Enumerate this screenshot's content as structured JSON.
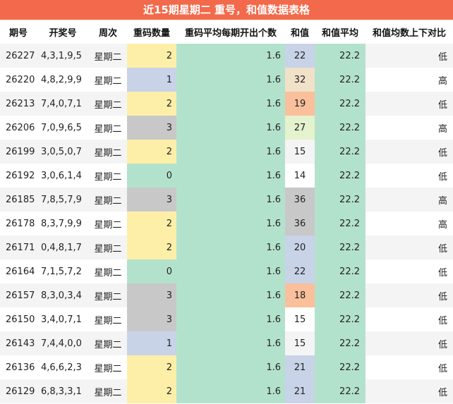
{
  "title": "近15期星期二 重号，和值数据表格",
  "headers": [
    "期号",
    "开奖号",
    "周次",
    "重码数量",
    "重码平均每期开出个数",
    "和值",
    "和值平均",
    "和值均数上下对比"
  ],
  "colors": {
    "header_bar": "#f26a4b",
    "avg_columns": "#b3e2cc",
    "dup_2": "#fdefa8",
    "dup_1": "#c8d3e8",
    "dup_3": "#c8c8c8",
    "dup_0": "#b3e2cc",
    "sum_blue": "#c8d3e8",
    "sum_beige": "#f1e1c8",
    "sum_orange": "#f9c09b",
    "sum_lightgreen": "#e4f2cd",
    "sum_gray": "#c8c8c8"
  },
  "rows": [
    {
      "period": "26227",
      "numbers": "4,3,1,9,5",
      "weekday": "星期二",
      "dup": "2",
      "avg_dup": "1.6",
      "sum": "22",
      "avg_sum": "22.2",
      "compare": "低",
      "dup_color": "#fdefa8",
      "sum_color": "#c8d3e8"
    },
    {
      "period": "26220",
      "numbers": "4,8,2,9,9",
      "weekday": "星期二",
      "dup": "1",
      "avg_dup": "1.6",
      "sum": "32",
      "avg_sum": "22.2",
      "compare": "高",
      "dup_color": "#c8d3e8",
      "sum_color": "#f1e1c8"
    },
    {
      "period": "26213",
      "numbers": "7,4,0,7,1",
      "weekday": "星期二",
      "dup": "2",
      "avg_dup": "1.6",
      "sum": "19",
      "avg_sum": "22.2",
      "compare": "低",
      "dup_color": "#fdefa8",
      "sum_color": "#f9c09b"
    },
    {
      "period": "26206",
      "numbers": "7,0,9,6,5",
      "weekday": "星期二",
      "dup": "3",
      "avg_dup": "1.6",
      "sum": "27",
      "avg_sum": "22.2",
      "compare": "高",
      "dup_color": "#c8c8c8",
      "sum_color": "#e4f2cd"
    },
    {
      "period": "26199",
      "numbers": "3,0,5,0,7",
      "weekday": "星期二",
      "dup": "2",
      "avg_dup": "1.6",
      "sum": "15",
      "avg_sum": "22.2",
      "compare": "低",
      "dup_color": "#fdefa8",
      "sum_color": ""
    },
    {
      "period": "26192",
      "numbers": "3,0,6,1,4",
      "weekday": "星期二",
      "dup": "0",
      "avg_dup": "1.6",
      "sum": "14",
      "avg_sum": "22.2",
      "compare": "低",
      "dup_color": "#b3e2cc",
      "sum_color": ""
    },
    {
      "period": "26185",
      "numbers": "7,8,5,7,9",
      "weekday": "星期二",
      "dup": "3",
      "avg_dup": "1.6",
      "sum": "36",
      "avg_sum": "22.2",
      "compare": "高",
      "dup_color": "#c8c8c8",
      "sum_color": "#c8c8c8"
    },
    {
      "period": "26178",
      "numbers": "8,3,7,9,9",
      "weekday": "星期二",
      "dup": "2",
      "avg_dup": "1.6",
      "sum": "36",
      "avg_sum": "22.2",
      "compare": "高",
      "dup_color": "#fdefa8",
      "sum_color": "#c8c8c8"
    },
    {
      "period": "26171",
      "numbers": "0,4,8,1,7",
      "weekday": "星期二",
      "dup": "2",
      "avg_dup": "1.6",
      "sum": "20",
      "avg_sum": "22.2",
      "compare": "低",
      "dup_color": "#fdefa8",
      "sum_color": "#c8d3e8"
    },
    {
      "period": "26164",
      "numbers": "7,1,5,7,2",
      "weekday": "星期二",
      "dup": "0",
      "avg_dup": "1.6",
      "sum": "22",
      "avg_sum": "22.2",
      "compare": "低",
      "dup_color": "#b3e2cc",
      "sum_color": "#c8d3e8"
    },
    {
      "period": "26157",
      "numbers": "8,3,0,3,4",
      "weekday": "星期二",
      "dup": "3",
      "avg_dup": "1.6",
      "sum": "18",
      "avg_sum": "22.2",
      "compare": "低",
      "dup_color": "#c8c8c8",
      "sum_color": "#f9c09b"
    },
    {
      "period": "26150",
      "numbers": "3,4,0,7,1",
      "weekday": "星期二",
      "dup": "3",
      "avg_dup": "1.6",
      "sum": "15",
      "avg_sum": "22.2",
      "compare": "低",
      "dup_color": "#c8c8c8",
      "sum_color": ""
    },
    {
      "period": "26143",
      "numbers": "7,4,4,0,0",
      "weekday": "星期二",
      "dup": "1",
      "avg_dup": "1.6",
      "sum": "15",
      "avg_sum": "22.2",
      "compare": "低",
      "dup_color": "#c8d3e8",
      "sum_color": ""
    },
    {
      "period": "26136",
      "numbers": "4,6,6,2,3",
      "weekday": "星期二",
      "dup": "2",
      "avg_dup": "1.6",
      "sum": "21",
      "avg_sum": "22.2",
      "compare": "低",
      "dup_color": "#fdefa8",
      "sum_color": "#c8d3e8"
    },
    {
      "period": "26129",
      "numbers": "6,8,3,3,1",
      "weekday": "星期二",
      "dup": "2",
      "avg_dup": "1.6",
      "sum": "21",
      "avg_sum": "22.2",
      "compare": "低",
      "dup_color": "#fdefa8",
      "sum_color": "#c8d3e8"
    }
  ]
}
